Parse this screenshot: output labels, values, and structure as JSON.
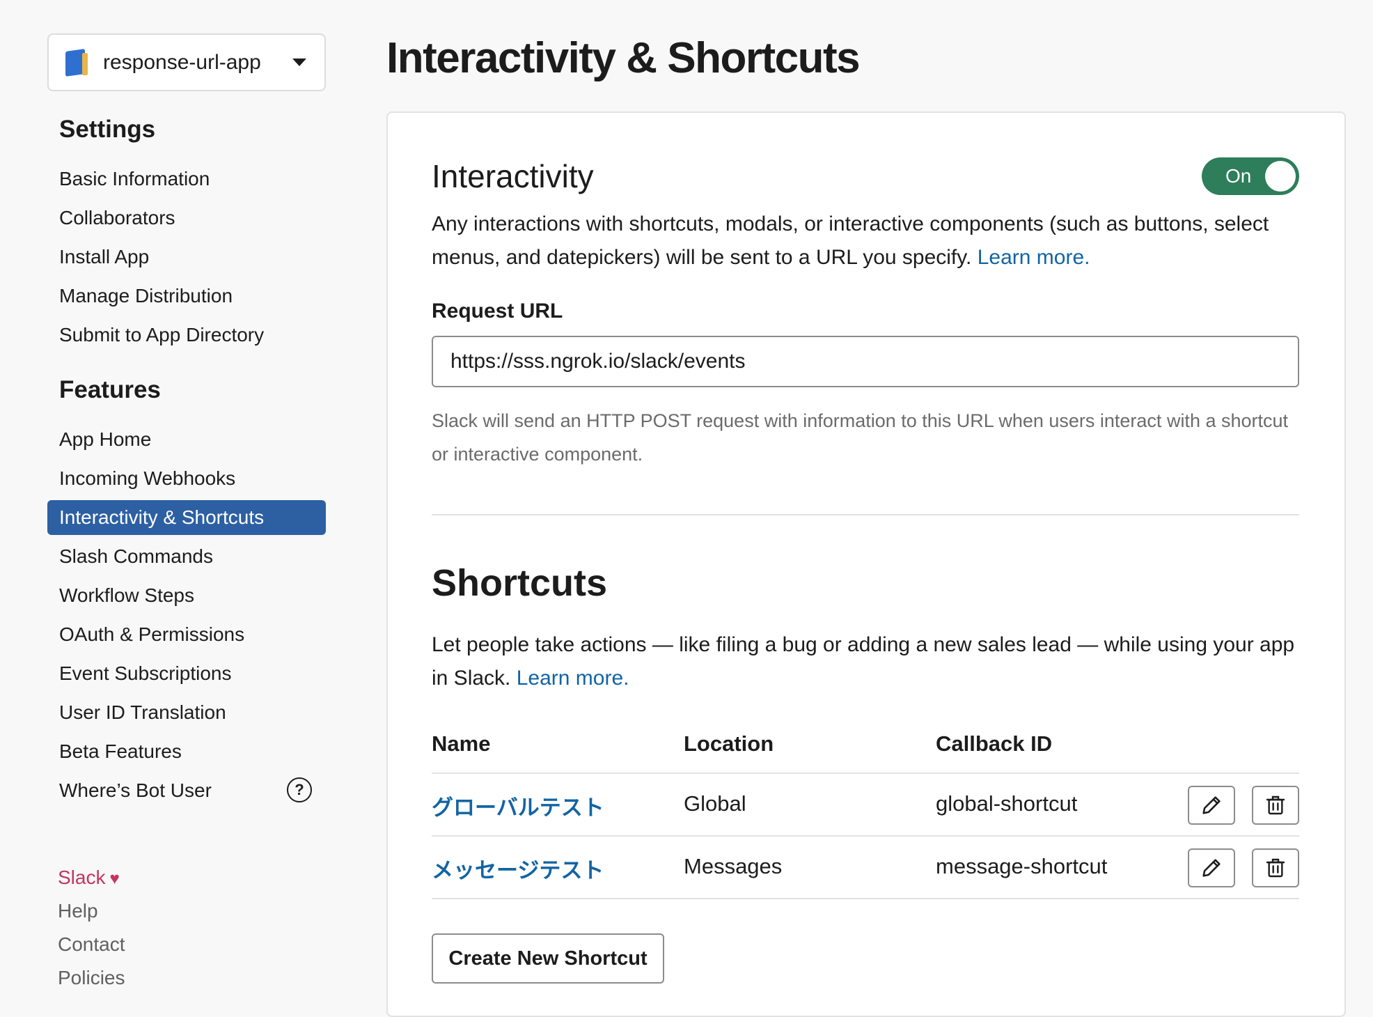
{
  "app_switcher": {
    "name": "response-url-app"
  },
  "sidebar": {
    "settings_title": "Settings",
    "settings_items": [
      {
        "label": "Basic Information"
      },
      {
        "label": "Collaborators"
      },
      {
        "label": "Install App"
      },
      {
        "label": "Manage Distribution"
      },
      {
        "label": "Submit to App Directory"
      }
    ],
    "features_title": "Features",
    "features_items": [
      {
        "label": "App Home"
      },
      {
        "label": "Incoming Webhooks"
      },
      {
        "label": "Interactivity & Shortcuts",
        "active": true
      },
      {
        "label": "Slash Commands"
      },
      {
        "label": "Workflow Steps"
      },
      {
        "label": "OAuth & Permissions"
      },
      {
        "label": "Event Subscriptions"
      },
      {
        "label": "User ID Translation"
      },
      {
        "label": "Beta Features"
      },
      {
        "label": "Where’s Bot User"
      }
    ],
    "help_glyph": "?",
    "footer": {
      "slack": "Slack",
      "heart": "♥",
      "help": "Help",
      "contact": "Contact",
      "policies": "Policies"
    }
  },
  "main": {
    "page_title": "Interactivity & Shortcuts",
    "interactivity": {
      "title": "Interactivity",
      "toggle_label": "On",
      "description": "Any interactions with shortcuts, modals, or interactive components (such as buttons, select menus, and datepickers) will be sent to a URL you specify.",
      "learn_more": "Learn more.",
      "request_url_label": "Request URL",
      "request_url_value": "https://sss.ngrok.io/slack/events",
      "hint": "Slack will send an HTTP POST request with information to this URL when users interact with a shortcut or interactive component."
    },
    "shortcuts": {
      "title": "Shortcuts",
      "description": "Let people take actions — like filing a bug or adding a new sales lead — while using your app in Slack.",
      "learn_more": "Learn more.",
      "columns": {
        "name": "Name",
        "location": "Location",
        "callback_id": "Callback ID"
      },
      "rows": [
        {
          "name": "グローバルテスト",
          "location": "Global",
          "callback_id": "global-shortcut"
        },
        {
          "name": "メッセージテスト",
          "location": "Messages",
          "callback_id": "message-shortcut"
        }
      ],
      "create_button": "Create New Shortcut"
    }
  },
  "colors": {
    "accent": "#2d60a3",
    "toggle_on": "#2e7d5b",
    "link": "#1264a3",
    "brand": "#c3365e"
  }
}
